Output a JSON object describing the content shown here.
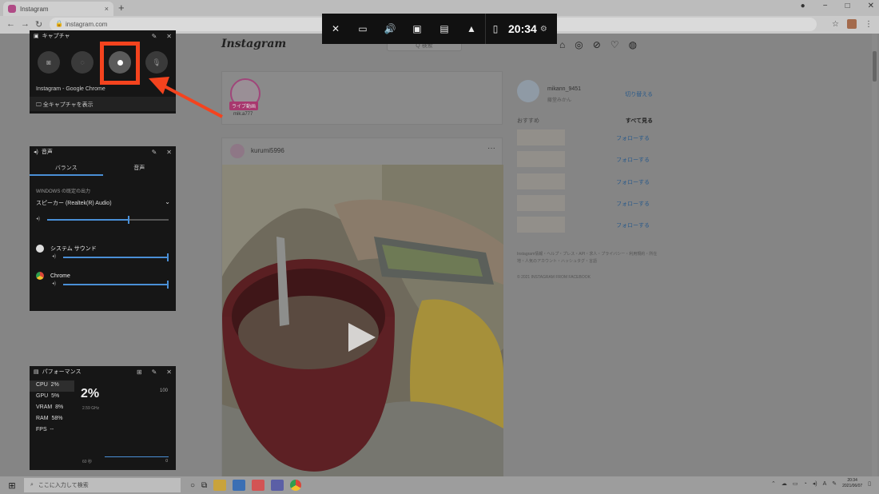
{
  "browser": {
    "tab_title": "Instagram",
    "new_tab": "+",
    "tab_close": "×",
    "url": "instagram.com",
    "window_controls": [
      "●",
      "−",
      "□",
      "✕"
    ]
  },
  "instagram": {
    "logo": "Instagram",
    "search_placeholder": "Q 検索",
    "story": {
      "live_badge": "ライブ動画",
      "username": "mik.a777"
    },
    "post": {
      "username": "kurumi5996",
      "more": "···"
    },
    "sidebar": {
      "username": "mikann_9451",
      "subtext": "藤堂みかん",
      "switch": "切り替える",
      "suggestions_title": "おすすめ",
      "see_all": "すべて見る",
      "suggestions": [
        {
          "follow": "フォローする"
        },
        {
          "follow": "フォローする"
        },
        {
          "follow": "フォローする"
        },
        {
          "follow": "フォローする"
        },
        {
          "follow": "フォローする"
        }
      ],
      "footer": "Instagram情報・ヘルプ・プレス・API・求人・プライバシー・利用規約・所在地・人気のアカウント・ハッシュタグ・言語",
      "copyright": "© 2021 INSTAGRAM FROM FACEBOOK"
    }
  },
  "gamebar": {
    "time": "20:34",
    "icons": [
      "xbox-icon",
      "widget-menu-icon",
      "audio-icon",
      "capture-icon",
      "performance-icon",
      "resources-icon"
    ]
  },
  "capture": {
    "title": "キャプチャ",
    "app": "Instagram - Google Chrome",
    "show_all": "全キャプチャを表示"
  },
  "audio": {
    "title": "音声",
    "tab_mix": "バランス",
    "tab_voice": "音声",
    "output_label": "WINDOWS の既定の出力",
    "device": "スピーカー (Realtek(R) Audio)",
    "apps": [
      {
        "name": "システム サウンド"
      },
      {
        "name": "Chrome"
      }
    ],
    "master_level": 0.68,
    "app_levels": [
      1.0,
      1.0
    ]
  },
  "performance": {
    "title": "パフォーマンス",
    "metrics": [
      {
        "label": "CPU",
        "value": "2%"
      },
      {
        "label": "GPU",
        "value": "5%"
      },
      {
        "label": "VRAM",
        "value": "8%"
      },
      {
        "label": "RAM",
        "value": "58%"
      },
      {
        "label": "FPS",
        "value": "--"
      }
    ],
    "current": "2%",
    "clock": "2.59 GHz",
    "max": "100",
    "duration": "60 秒",
    "min": "0"
  },
  "taskbar": {
    "search_placeholder": "ここに入力して検索",
    "clock_time": "20:34",
    "clock_date": "2021/06/07"
  },
  "colors": {
    "highlight": "#f4431e",
    "accent": "#4a8fd6"
  }
}
